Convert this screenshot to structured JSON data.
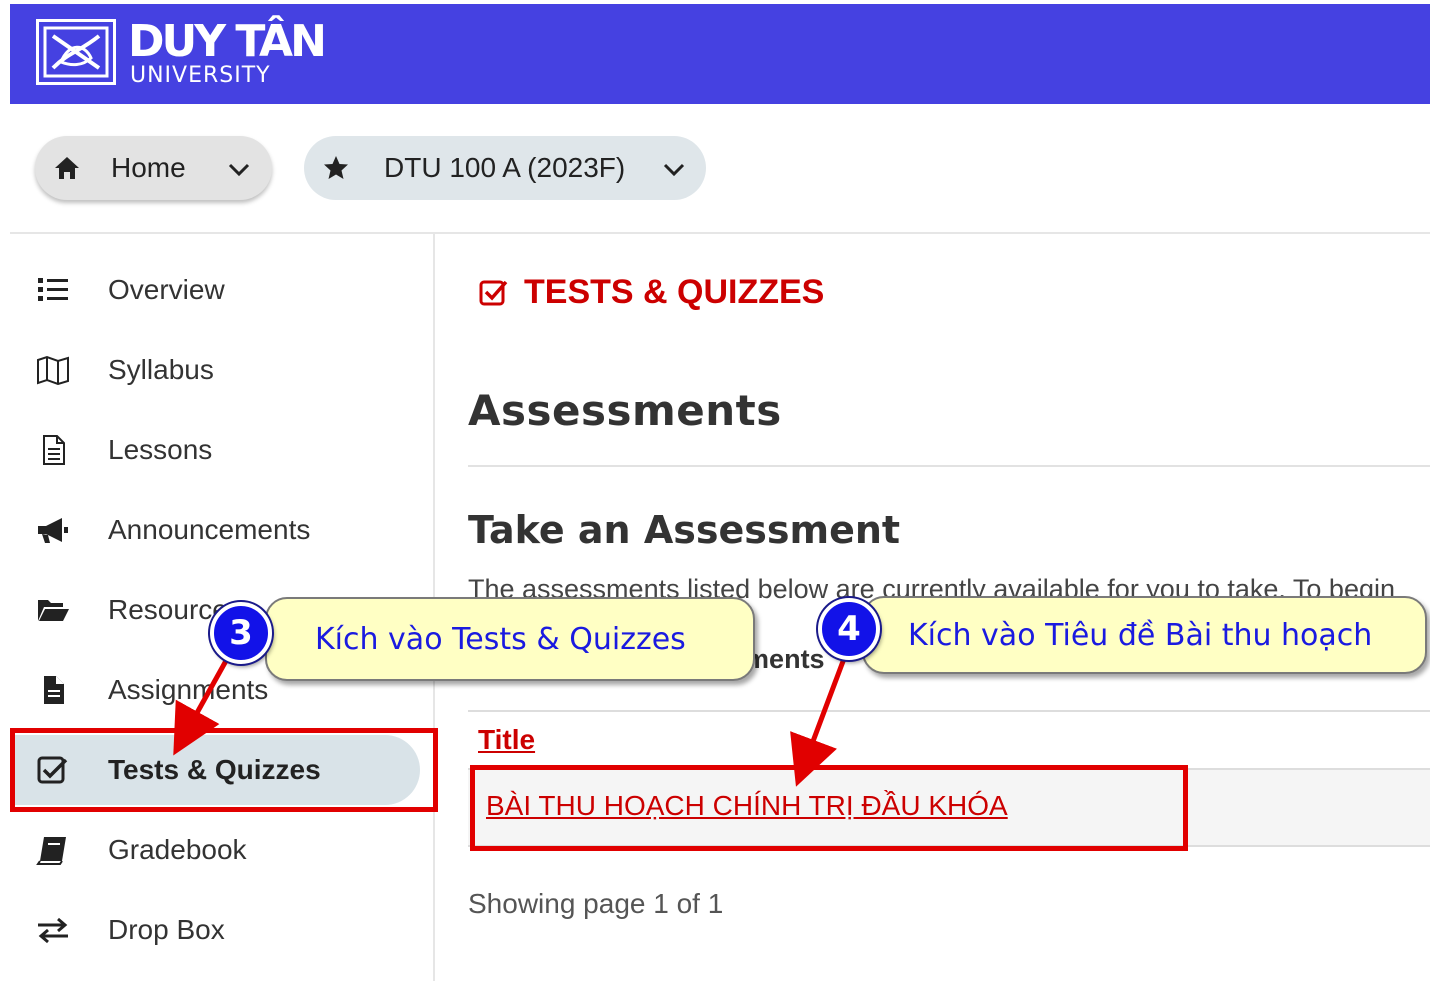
{
  "header": {
    "logo_name": "DUY TÂN",
    "logo_sub": "UNIVERSITY",
    "bg_color": "#4541e1"
  },
  "breadcrumb": [
    {
      "label": "Home",
      "icon": "home-icon"
    },
    {
      "label": "DTU 100 A (2023F)",
      "icon": "star-icon"
    }
  ],
  "sidebar": {
    "items": [
      {
        "label": "Overview",
        "icon": "list-icon"
      },
      {
        "label": "Syllabus",
        "icon": "map-icon"
      },
      {
        "label": "Lessons",
        "icon": "file-text-icon"
      },
      {
        "label": "Announcements",
        "icon": "bullhorn-icon"
      },
      {
        "label": "Resources",
        "icon": "folder-open-icon"
      },
      {
        "label": "Assignments",
        "icon": "file-icon"
      },
      {
        "label": "Tests & Quizzes",
        "icon": "check-square-icon",
        "active": true
      },
      {
        "label": "Gradebook",
        "icon": "book-icon"
      },
      {
        "label": "Drop Box",
        "icon": "exchange-icon"
      }
    ]
  },
  "main": {
    "tool_title": "TESTS & QUIZZES",
    "heading": "Assessments",
    "subheading": "Take an Assessment",
    "intro": "The assessments listed below are currently available for you to take. To begin",
    "section_fragment": "essments",
    "table": {
      "columns": [
        "Title"
      ],
      "rows": [
        {
          "title": "BÀI THU HOẠCH CHÍNH TRỊ ĐẦU KHÓA"
        }
      ]
    },
    "paging": "Showing page 1 of 1"
  },
  "annotations": [
    {
      "number": "3",
      "text": "Kích vào Tests & Quizzes"
    },
    {
      "number": "4",
      "text": "Kích vào Tiêu đề Bài thu hoạch"
    }
  ],
  "colors": {
    "accent_red": "#cc0000",
    "annotation_red": "#e10000",
    "callout_bg": "#ffffc4",
    "callout_text": "#1a1ae0",
    "active_nav_bg": "#d9e3e8"
  }
}
